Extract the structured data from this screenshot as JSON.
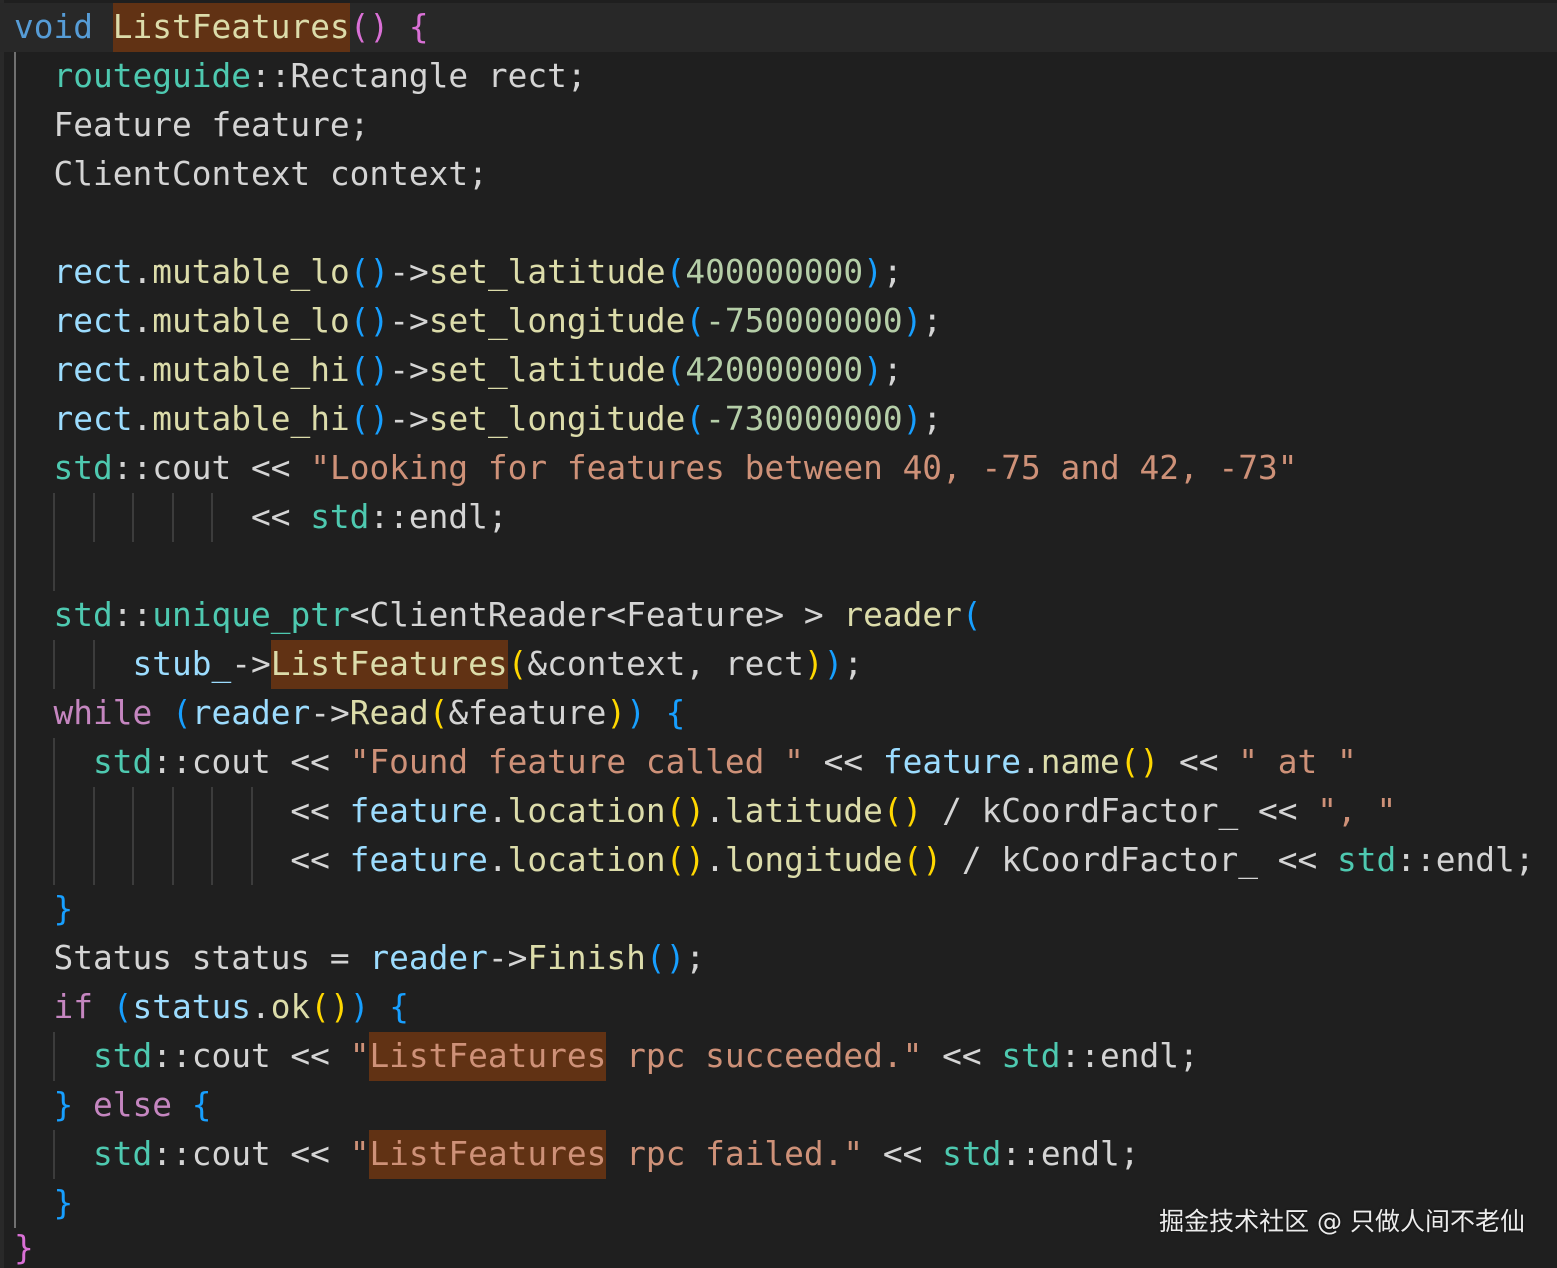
{
  "theme": {
    "editor_background": "#1f1f1f",
    "current_line_background": "#282828",
    "indent_guide": "#3c3c3c",
    "active_indent_guide": "#707070"
  },
  "editor": {
    "lines": [
      [
        [
          "void ",
          "#569cd6"
        ],
        [
          "ListFeatures",
          "#dcdcaa",
          "#613214"
        ],
        [
          "() {",
          "#da70d6"
        ]
      ],
      [
        [
          "  routeguide",
          "#4ec9b0"
        ],
        [
          "::Rectangle rect;",
          "#d4d4d4"
        ]
      ],
      [
        [
          "  Feature feature;",
          "#d4d4d4"
        ]
      ],
      [
        [
          "  ClientContext context;",
          "#d4d4d4"
        ]
      ],
      [],
      [
        [
          "  rect",
          "#9cdcfe"
        ],
        [
          ".",
          "#d4d4d4"
        ],
        [
          "mutable_lo",
          "#dcdcaa"
        ],
        [
          "()",
          "#179fff"
        ],
        [
          "->",
          "#d4d4d4"
        ],
        [
          "set_latitude",
          "#dcdcaa"
        ],
        [
          "(",
          "#179fff"
        ],
        [
          "400000000",
          "#b5cea8"
        ],
        [
          ")",
          "#179fff"
        ],
        [
          ";",
          "#d4d4d4"
        ]
      ],
      [
        [
          "  rect",
          "#9cdcfe"
        ],
        [
          ".",
          "#d4d4d4"
        ],
        [
          "mutable_lo",
          "#dcdcaa"
        ],
        [
          "()",
          "#179fff"
        ],
        [
          "->",
          "#d4d4d4"
        ],
        [
          "set_longitude",
          "#dcdcaa"
        ],
        [
          "(",
          "#179fff"
        ],
        [
          "-750000000",
          "#b5cea8"
        ],
        [
          ")",
          "#179fff"
        ],
        [
          ";",
          "#d4d4d4"
        ]
      ],
      [
        [
          "  rect",
          "#9cdcfe"
        ],
        [
          ".",
          "#d4d4d4"
        ],
        [
          "mutable_hi",
          "#dcdcaa"
        ],
        [
          "()",
          "#179fff"
        ],
        [
          "->",
          "#d4d4d4"
        ],
        [
          "set_latitude",
          "#dcdcaa"
        ],
        [
          "(",
          "#179fff"
        ],
        [
          "420000000",
          "#b5cea8"
        ],
        [
          ")",
          "#179fff"
        ],
        [
          ";",
          "#d4d4d4"
        ]
      ],
      [
        [
          "  rect",
          "#9cdcfe"
        ],
        [
          ".",
          "#d4d4d4"
        ],
        [
          "mutable_hi",
          "#dcdcaa"
        ],
        [
          "()",
          "#179fff"
        ],
        [
          "->",
          "#d4d4d4"
        ],
        [
          "set_longitude",
          "#dcdcaa"
        ],
        [
          "(",
          "#179fff"
        ],
        [
          "-730000000",
          "#b5cea8"
        ],
        [
          ")",
          "#179fff"
        ],
        [
          ";",
          "#d4d4d4"
        ]
      ],
      [
        [
          "  std",
          "#4ec9b0"
        ],
        [
          "::cout << ",
          "#d4d4d4"
        ],
        [
          "\"Looking for features between 40, -75 and 42, -73\"",
          "#ce9178"
        ]
      ],
      [
        [
          "            << ",
          "#d4d4d4"
        ],
        [
          "std",
          "#4ec9b0"
        ],
        [
          "::endl;",
          "#d4d4d4"
        ]
      ],
      [],
      [
        [
          "  std",
          "#4ec9b0"
        ],
        [
          "::",
          "#d4d4d4"
        ],
        [
          "unique_ptr",
          "#4ec9b0"
        ],
        [
          "<ClientReader<Feature> > ",
          "#d4d4d4"
        ],
        [
          "reader",
          "#dcdcaa"
        ],
        [
          "(",
          "#179fff"
        ]
      ],
      [
        [
          "      stub_",
          "#9cdcfe"
        ],
        [
          "->",
          "#d4d4d4"
        ],
        [
          "ListFeatures",
          "#dcdcaa",
          "#613214"
        ],
        [
          "(",
          "#ffd700"
        ],
        [
          "&context, rect",
          "#d4d4d4"
        ],
        [
          ")",
          "#ffd700"
        ],
        [
          ")",
          "#179fff"
        ],
        [
          ";",
          "#d4d4d4"
        ]
      ],
      [
        [
          "  while ",
          "#c586c0"
        ],
        [
          "(",
          "#179fff"
        ],
        [
          "reader",
          "#9cdcfe"
        ],
        [
          "->",
          "#d4d4d4"
        ],
        [
          "Read",
          "#dcdcaa"
        ],
        [
          "(",
          "#ffd700"
        ],
        [
          "&feature",
          "#d4d4d4"
        ],
        [
          ")",
          "#ffd700"
        ],
        [
          ") {",
          "#179fff"
        ]
      ],
      [
        [
          "    std",
          "#4ec9b0"
        ],
        [
          "::cout << ",
          "#d4d4d4"
        ],
        [
          "\"Found feature called \"",
          "#ce9178"
        ],
        [
          " << ",
          "#d4d4d4"
        ],
        [
          "feature",
          "#9cdcfe"
        ],
        [
          ".",
          "#d4d4d4"
        ],
        [
          "name",
          "#dcdcaa"
        ],
        [
          "()",
          "#ffd700"
        ],
        [
          " << ",
          "#d4d4d4"
        ],
        [
          "\" at \"",
          "#ce9178"
        ]
      ],
      [
        [
          "              << ",
          "#d4d4d4"
        ],
        [
          "feature",
          "#9cdcfe"
        ],
        [
          ".",
          "#d4d4d4"
        ],
        [
          "location",
          "#dcdcaa"
        ],
        [
          "()",
          "#ffd700"
        ],
        [
          ".",
          "#d4d4d4"
        ],
        [
          "latitude",
          "#dcdcaa"
        ],
        [
          "()",
          "#ffd700"
        ],
        [
          " / kCoordFactor_ << ",
          "#d4d4d4"
        ],
        [
          "\", \"",
          "#ce9178"
        ]
      ],
      [
        [
          "              << ",
          "#d4d4d4"
        ],
        [
          "feature",
          "#9cdcfe"
        ],
        [
          ".",
          "#d4d4d4"
        ],
        [
          "location",
          "#dcdcaa"
        ],
        [
          "()",
          "#ffd700"
        ],
        [
          ".",
          "#d4d4d4"
        ],
        [
          "longitude",
          "#dcdcaa"
        ],
        [
          "()",
          "#ffd700"
        ],
        [
          " / kCoordFactor_ << ",
          "#d4d4d4"
        ],
        [
          "std",
          "#4ec9b0"
        ],
        [
          "::endl;",
          "#d4d4d4"
        ]
      ],
      [
        [
          "  }",
          "#179fff"
        ]
      ],
      [
        [
          "  Status status = ",
          "#d4d4d4"
        ],
        [
          "reader",
          "#9cdcfe"
        ],
        [
          "->",
          "#d4d4d4"
        ],
        [
          "Finish",
          "#dcdcaa"
        ],
        [
          "()",
          "#179fff"
        ],
        [
          ";",
          "#d4d4d4"
        ]
      ],
      [
        [
          "  if ",
          "#c586c0"
        ],
        [
          "(",
          "#179fff"
        ],
        [
          "status",
          "#9cdcfe"
        ],
        [
          ".",
          "#d4d4d4"
        ],
        [
          "ok",
          "#dcdcaa"
        ],
        [
          "()",
          "#ffd700"
        ],
        [
          ") {",
          "#179fff"
        ]
      ],
      [
        [
          "    std",
          "#4ec9b0"
        ],
        [
          "::cout << ",
          "#d4d4d4"
        ],
        [
          "\"",
          "#ce9178"
        ],
        [
          "ListFeatures",
          "#ce9178",
          "#613214"
        ],
        [
          " rpc succeeded.\"",
          "#ce9178"
        ],
        [
          " << ",
          "#d4d4d4"
        ],
        [
          "std",
          "#4ec9b0"
        ],
        [
          "::endl;",
          "#d4d4d4"
        ]
      ],
      [
        [
          "  } ",
          "#179fff"
        ],
        [
          "else ",
          "#c586c0"
        ],
        [
          "{",
          "#179fff"
        ]
      ],
      [
        [
          "    std",
          "#4ec9b0"
        ],
        [
          "::cout << ",
          "#d4d4d4"
        ],
        [
          "\"",
          "#ce9178"
        ],
        [
          "ListFeatures",
          "#ce9178",
          "#613214"
        ],
        [
          " rpc failed.\"",
          "#ce9178"
        ],
        [
          " << ",
          "#d4d4d4"
        ],
        [
          "std",
          "#4ec9b0"
        ],
        [
          "::endl;",
          "#d4d4d4"
        ]
      ],
      [
        [
          "  }",
          "#179fff"
        ]
      ],
      [
        [
          "}",
          "#da70d6"
        ]
      ]
    ]
  },
  "watermark": {
    "text": "掘金技术社区 @ 只做人间不老仙"
  }
}
